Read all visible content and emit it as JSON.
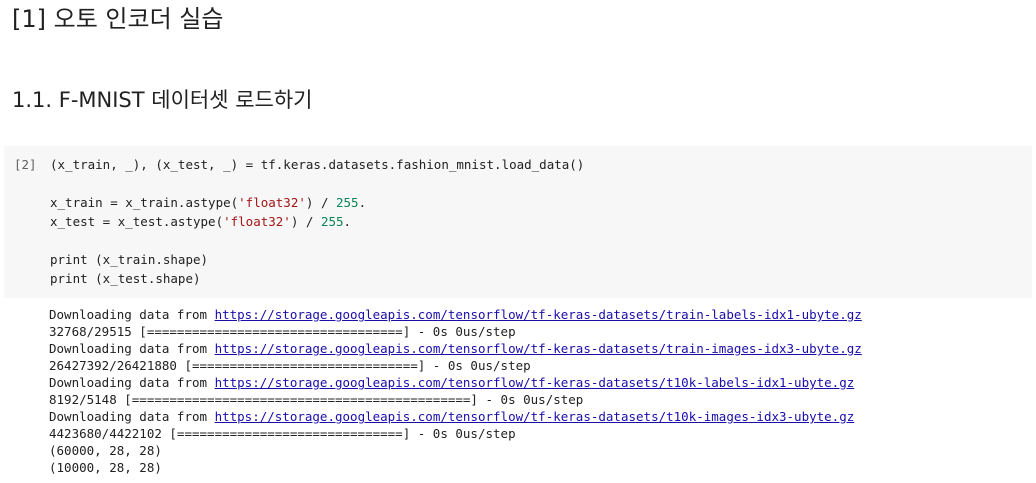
{
  "headings": {
    "title": "[1] 오토 인코더 실습",
    "section": "1.1. F-MNIST 데이터셋 로드하기"
  },
  "cell": {
    "execution_count": "[2]",
    "code_lines": [
      "(x_train, _), (x_test, _) = tf.keras.datasets.fashion_mnist.load_data()",
      "",
      "x_train = x_train.astype('float32') / 255.",
      "x_test = x_test.astype('float32') / 255.",
      "",
      "print (x_train.shape)",
      "print (x_test.shape)"
    ]
  },
  "output": {
    "lines": [
      {
        "text": "Downloading data from ",
        "link": "https://storage.googleapis.com/tensorflow/tf-keras-datasets/train-labels-idx1-ubyte.gz"
      },
      {
        "text": "32768/29515 [==================================] - 0s 0us/step"
      },
      {
        "text": "Downloading data from ",
        "link": "https://storage.googleapis.com/tensorflow/tf-keras-datasets/train-images-idx3-ubyte.gz"
      },
      {
        "text": "26427392/26421880 [==============================] - 0s 0us/step"
      },
      {
        "text": "Downloading data from ",
        "link": "https://storage.googleapis.com/tensorflow/tf-keras-datasets/t10k-labels-idx1-ubyte.gz"
      },
      {
        "text": "8192/5148 [=============================================] - 0s 0us/step"
      },
      {
        "text": "Downloading data from ",
        "link": "https://storage.googleapis.com/tensorflow/tf-keras-datasets/t10k-images-idx3-ubyte.gz"
      },
      {
        "text": "4423680/4422102 [==============================] - 0s 0us/step"
      },
      {
        "text": "(60000, 28, 28)"
      },
      {
        "text": "(10000, 28, 28)"
      }
    ]
  }
}
